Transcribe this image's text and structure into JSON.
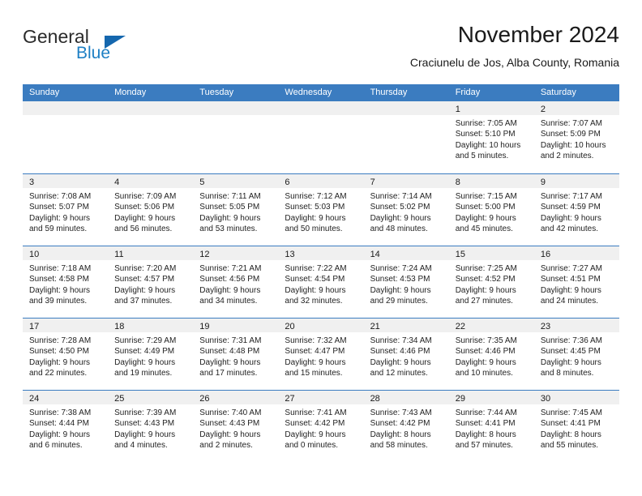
{
  "brand": {
    "name_top": "General",
    "name_bottom": "Blue",
    "accent_color": "#1567ae",
    "text_color": "#2b2b2b"
  },
  "header": {
    "title": "November 2024",
    "subtitle": "Craciunelu de Jos, Alba County, Romania"
  },
  "theme": {
    "header_bg": "#3b7cc0",
    "header_text": "#ffffff",
    "day_band_bg": "#f0f0f0",
    "row_divider": "#3b7cc0",
    "body_text": "#222222"
  },
  "weekdays": [
    "Sunday",
    "Monday",
    "Tuesday",
    "Wednesday",
    "Thursday",
    "Friday",
    "Saturday"
  ],
  "weeks": [
    [
      {
        "day": "",
        "empty": true
      },
      {
        "day": "",
        "empty": true
      },
      {
        "day": "",
        "empty": true
      },
      {
        "day": "",
        "empty": true
      },
      {
        "day": "",
        "empty": true
      },
      {
        "day": "1",
        "sunrise": "Sunrise: 7:05 AM",
        "sunset": "Sunset: 5:10 PM",
        "daylight1": "Daylight: 10 hours",
        "daylight2": "and 5 minutes."
      },
      {
        "day": "2",
        "sunrise": "Sunrise: 7:07 AM",
        "sunset": "Sunset: 5:09 PM",
        "daylight1": "Daylight: 10 hours",
        "daylight2": "and 2 minutes."
      }
    ],
    [
      {
        "day": "3",
        "sunrise": "Sunrise: 7:08 AM",
        "sunset": "Sunset: 5:07 PM",
        "daylight1": "Daylight: 9 hours",
        "daylight2": "and 59 minutes."
      },
      {
        "day": "4",
        "sunrise": "Sunrise: 7:09 AM",
        "sunset": "Sunset: 5:06 PM",
        "daylight1": "Daylight: 9 hours",
        "daylight2": "and 56 minutes."
      },
      {
        "day": "5",
        "sunrise": "Sunrise: 7:11 AM",
        "sunset": "Sunset: 5:05 PM",
        "daylight1": "Daylight: 9 hours",
        "daylight2": "and 53 minutes."
      },
      {
        "day": "6",
        "sunrise": "Sunrise: 7:12 AM",
        "sunset": "Sunset: 5:03 PM",
        "daylight1": "Daylight: 9 hours",
        "daylight2": "and 50 minutes."
      },
      {
        "day": "7",
        "sunrise": "Sunrise: 7:14 AM",
        "sunset": "Sunset: 5:02 PM",
        "daylight1": "Daylight: 9 hours",
        "daylight2": "and 48 minutes."
      },
      {
        "day": "8",
        "sunrise": "Sunrise: 7:15 AM",
        "sunset": "Sunset: 5:00 PM",
        "daylight1": "Daylight: 9 hours",
        "daylight2": "and 45 minutes."
      },
      {
        "day": "9",
        "sunrise": "Sunrise: 7:17 AM",
        "sunset": "Sunset: 4:59 PM",
        "daylight1": "Daylight: 9 hours",
        "daylight2": "and 42 minutes."
      }
    ],
    [
      {
        "day": "10",
        "sunrise": "Sunrise: 7:18 AM",
        "sunset": "Sunset: 4:58 PM",
        "daylight1": "Daylight: 9 hours",
        "daylight2": "and 39 minutes."
      },
      {
        "day": "11",
        "sunrise": "Sunrise: 7:20 AM",
        "sunset": "Sunset: 4:57 PM",
        "daylight1": "Daylight: 9 hours",
        "daylight2": "and 37 minutes."
      },
      {
        "day": "12",
        "sunrise": "Sunrise: 7:21 AM",
        "sunset": "Sunset: 4:56 PM",
        "daylight1": "Daylight: 9 hours",
        "daylight2": "and 34 minutes."
      },
      {
        "day": "13",
        "sunrise": "Sunrise: 7:22 AM",
        "sunset": "Sunset: 4:54 PM",
        "daylight1": "Daylight: 9 hours",
        "daylight2": "and 32 minutes."
      },
      {
        "day": "14",
        "sunrise": "Sunrise: 7:24 AM",
        "sunset": "Sunset: 4:53 PM",
        "daylight1": "Daylight: 9 hours",
        "daylight2": "and 29 minutes."
      },
      {
        "day": "15",
        "sunrise": "Sunrise: 7:25 AM",
        "sunset": "Sunset: 4:52 PM",
        "daylight1": "Daylight: 9 hours",
        "daylight2": "and 27 minutes."
      },
      {
        "day": "16",
        "sunrise": "Sunrise: 7:27 AM",
        "sunset": "Sunset: 4:51 PM",
        "daylight1": "Daylight: 9 hours",
        "daylight2": "and 24 minutes."
      }
    ],
    [
      {
        "day": "17",
        "sunrise": "Sunrise: 7:28 AM",
        "sunset": "Sunset: 4:50 PM",
        "daylight1": "Daylight: 9 hours",
        "daylight2": "and 22 minutes."
      },
      {
        "day": "18",
        "sunrise": "Sunrise: 7:29 AM",
        "sunset": "Sunset: 4:49 PM",
        "daylight1": "Daylight: 9 hours",
        "daylight2": "and 19 minutes."
      },
      {
        "day": "19",
        "sunrise": "Sunrise: 7:31 AM",
        "sunset": "Sunset: 4:48 PM",
        "daylight1": "Daylight: 9 hours",
        "daylight2": "and 17 minutes."
      },
      {
        "day": "20",
        "sunrise": "Sunrise: 7:32 AM",
        "sunset": "Sunset: 4:47 PM",
        "daylight1": "Daylight: 9 hours",
        "daylight2": "and 15 minutes."
      },
      {
        "day": "21",
        "sunrise": "Sunrise: 7:34 AM",
        "sunset": "Sunset: 4:46 PM",
        "daylight1": "Daylight: 9 hours",
        "daylight2": "and 12 minutes."
      },
      {
        "day": "22",
        "sunrise": "Sunrise: 7:35 AM",
        "sunset": "Sunset: 4:46 PM",
        "daylight1": "Daylight: 9 hours",
        "daylight2": "and 10 minutes."
      },
      {
        "day": "23",
        "sunrise": "Sunrise: 7:36 AM",
        "sunset": "Sunset: 4:45 PM",
        "daylight1": "Daylight: 9 hours",
        "daylight2": "and 8 minutes."
      }
    ],
    [
      {
        "day": "24",
        "sunrise": "Sunrise: 7:38 AM",
        "sunset": "Sunset: 4:44 PM",
        "daylight1": "Daylight: 9 hours",
        "daylight2": "and 6 minutes."
      },
      {
        "day": "25",
        "sunrise": "Sunrise: 7:39 AM",
        "sunset": "Sunset: 4:43 PM",
        "daylight1": "Daylight: 9 hours",
        "daylight2": "and 4 minutes."
      },
      {
        "day": "26",
        "sunrise": "Sunrise: 7:40 AM",
        "sunset": "Sunset: 4:43 PM",
        "daylight1": "Daylight: 9 hours",
        "daylight2": "and 2 minutes."
      },
      {
        "day": "27",
        "sunrise": "Sunrise: 7:41 AM",
        "sunset": "Sunset: 4:42 PM",
        "daylight1": "Daylight: 9 hours",
        "daylight2": "and 0 minutes."
      },
      {
        "day": "28",
        "sunrise": "Sunrise: 7:43 AM",
        "sunset": "Sunset: 4:42 PM",
        "daylight1": "Daylight: 8 hours",
        "daylight2": "and 58 minutes."
      },
      {
        "day": "29",
        "sunrise": "Sunrise: 7:44 AM",
        "sunset": "Sunset: 4:41 PM",
        "daylight1": "Daylight: 8 hours",
        "daylight2": "and 57 minutes."
      },
      {
        "day": "30",
        "sunrise": "Sunrise: 7:45 AM",
        "sunset": "Sunset: 4:41 PM",
        "daylight1": "Daylight: 8 hours",
        "daylight2": "and 55 minutes."
      }
    ]
  ]
}
